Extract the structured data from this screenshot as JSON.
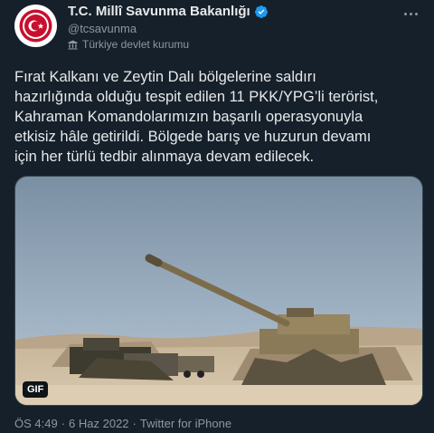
{
  "account": {
    "display_name": "T.C. Millî Savunma Bakanlığı",
    "handle": "@tcsavunma",
    "label": "Türkiye devlet kurumu",
    "verified_color": "#1d9bf0",
    "avatar_icon": "ministry-emblem-icon",
    "more_icon": "more-options-icon"
  },
  "tweet": {
    "text": "Fırat Kalkanı ve Zeytin Dalı bölgelerine saldırı\nhazırlığında olduğu tespit edilen 11 PKK/YPG’li terörist,\nKahraman Komandolarımızın başarılı operasyonuyla\netkisiz hâle getirildi. Bölgede barış ve huzurun devamı\niçin her türlü tedbir alınmaya devam edilecek.",
    "media_badge": "GIF"
  },
  "meta": {
    "time": "ÖS 4:49",
    "sep1": "·",
    "date": "6 Haz 2022",
    "sep2": "·",
    "source": "Twitter for iPhone"
  }
}
